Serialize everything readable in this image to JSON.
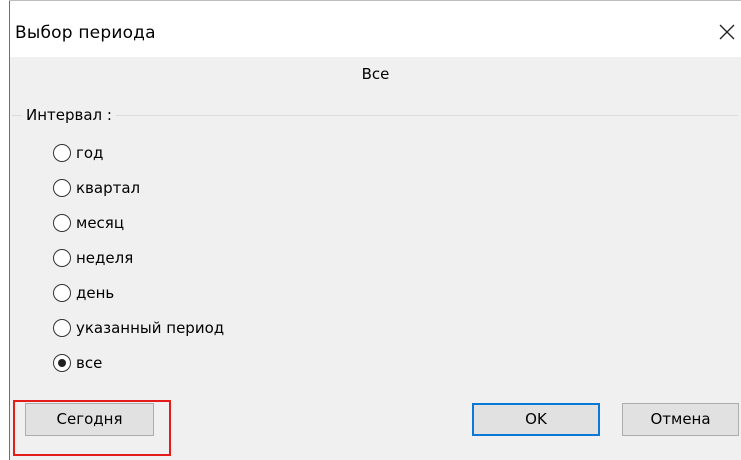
{
  "window": {
    "title": "Выбор периода",
    "close_icon": "close-icon"
  },
  "current_period": "Все",
  "interval": {
    "label": "Интервал :",
    "options": [
      {
        "label": "год",
        "selected": false
      },
      {
        "label": "квартал",
        "selected": false
      },
      {
        "label": "месяц",
        "selected": false
      },
      {
        "label": "неделя",
        "selected": false
      },
      {
        "label": "день",
        "selected": false
      },
      {
        "label": "указанный период",
        "selected": false
      },
      {
        "label": "все",
        "selected": true
      }
    ]
  },
  "buttons": {
    "today": "Сегодня",
    "ok": "OK",
    "cancel": "Отмена"
  },
  "colors": {
    "highlight": "#e41b1b",
    "default_button_border": "#0a78d7",
    "dialog_background": "#f0f0f0"
  }
}
